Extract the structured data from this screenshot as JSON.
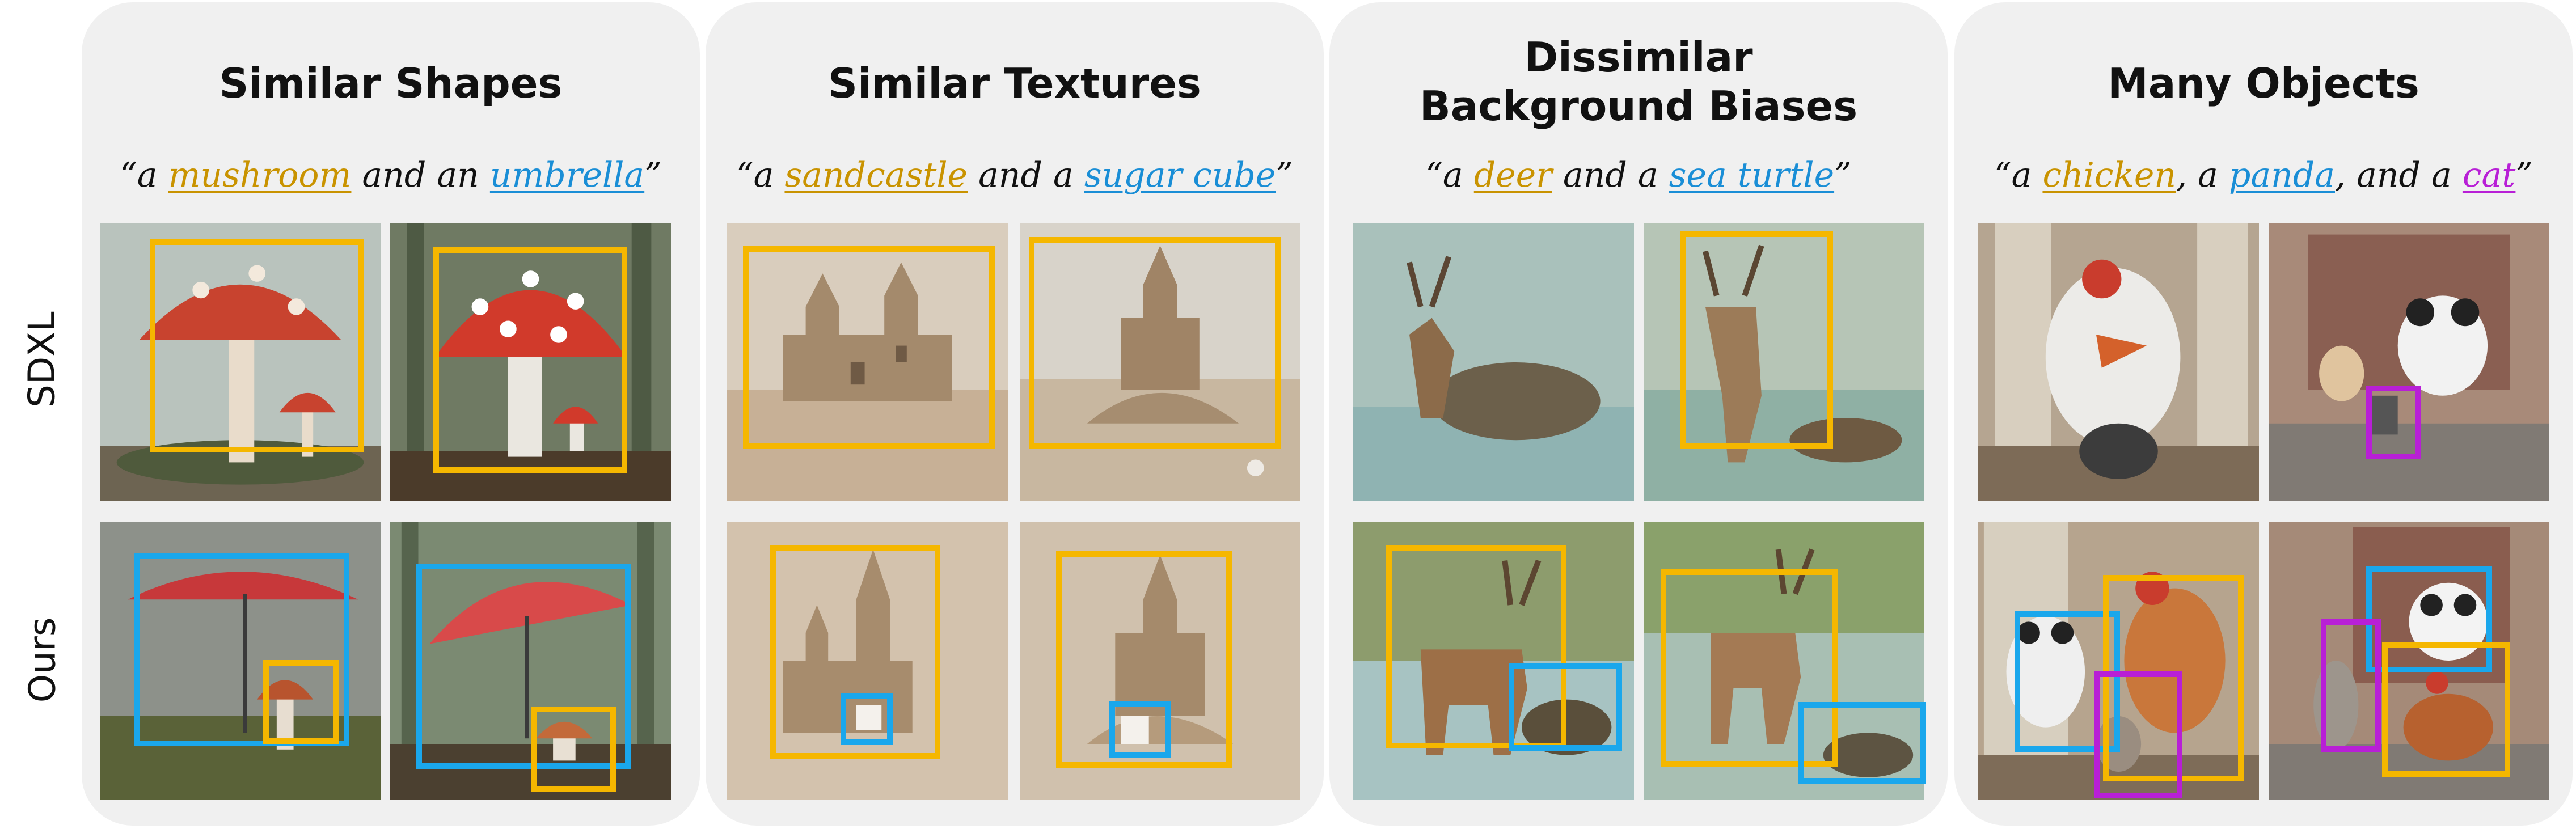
{
  "colors": {
    "first_object": "#F5B700",
    "second_object": "#1AA7EC",
    "third_object": "#B81FD6",
    "panel_bg": "#F0F0F0",
    "underlined_text_first": "#C99300",
    "underlined_text_second": "#1A8ED6",
    "underlined_text_third": "#B81FD6"
  },
  "row_labels": [
    "SDXL",
    "Ours"
  ],
  "panels": [
    {
      "title": "Similar Shapes",
      "prompt": {
        "open": "“a ",
        "obj1": "mushroom",
        "mid1": " and an ",
        "obj2": "umbrella",
        "mid2": "",
        "obj3": "",
        "close": "”"
      },
      "images": [
        "mushroom-sdxl-1",
        "mushroom-sdxl-2",
        "umbrella-mushroom-ours-1",
        "umbrella-mushroom-ours-2"
      ]
    },
    {
      "title": "Similar Textures",
      "prompt": {
        "open": "“a ",
        "obj1": "sandcastle",
        "mid1": " and a ",
        "obj2": "sugar cube",
        "mid2": "",
        "obj3": "",
        "close": "”"
      },
      "images": [
        "sandcastle-sdxl-1",
        "sandcastle-sdxl-2",
        "sandcastle-cube-ours-1",
        "sandcastle-cube-ours-2"
      ]
    },
    {
      "title": "Dissimilar\nBackground Biases",
      "title_line1": "Dissimilar",
      "title_line2": "Background Biases",
      "prompt": {
        "open": "“a ",
        "obj1": "deer",
        "mid1": " and a ",
        "obj2": "sea turtle",
        "mid2": "",
        "obj3": "",
        "close": "”"
      },
      "images": [
        "deer-turtle-sdxl-1",
        "deer-turtle-sdxl-2",
        "deer-turtle-ours-1",
        "deer-turtle-ours-2"
      ]
    },
    {
      "title": "Many Objects",
      "prompt": {
        "open": "“a ",
        "obj1": "chicken",
        "mid1": ", a ",
        "obj2": "panda",
        "mid2": ", and a ",
        "obj3": "cat",
        "close": "”"
      },
      "images": [
        "chicken-panda-cat-sdxl-1",
        "chicken-panda-cat-sdxl-2",
        "chicken-panda-cat-ours-1",
        "chicken-panda-cat-ours-2"
      ]
    }
  ]
}
